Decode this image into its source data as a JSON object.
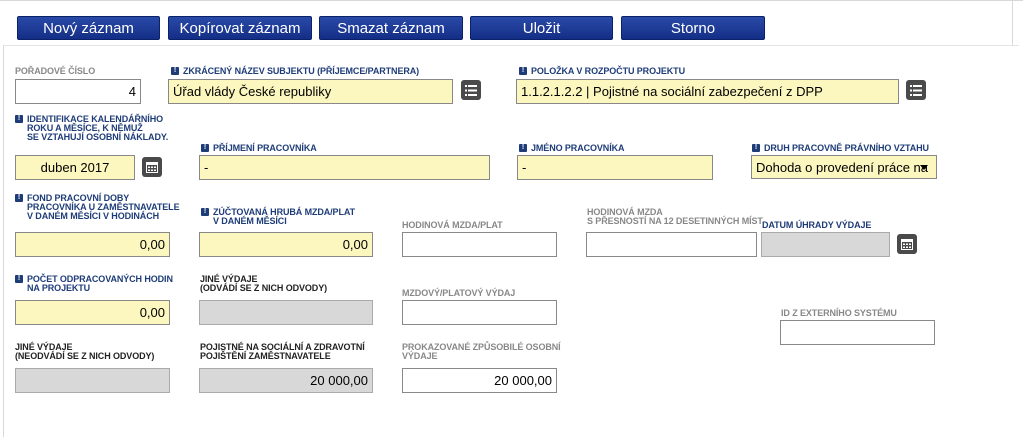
{
  "toolbar": {
    "new_label": "Nový záznam",
    "copy_label": "Kopírovat záznam",
    "delete_label": "Smazat záznam",
    "save_label": "Uložit",
    "cancel_label": "Storno"
  },
  "form": {
    "poradove_cislo": {
      "label": "POŘADOVÉ ČÍSLO",
      "value": "4"
    },
    "nazev_subjektu": {
      "label": "ZKRÁCENÝ NÁZEV SUBJEKTU (PŘÍJEMCE/PARTNERA)",
      "value": "Úřad vlády České republiky"
    },
    "polozka_rozpoctu": {
      "label": "POLOŽKA V ROZPOČTU PROJEKTU",
      "value": "1.1.2.1.2.2 | Pojistné na sociální zabezpečení z DPP"
    },
    "identifikace_roku": {
      "label_line1": "IDENTIFIKACE KALENDÁŘNÍHO",
      "label_line2": "ROKU A MĚSÍCE, K NĚMUŽ",
      "label_line3": "SE VZTAHUJÍ OSOBNÍ NÁKLADY.",
      "value": "duben 2017"
    },
    "prijmeni": {
      "label": "PŘÍJMENÍ PRACOVNÍKA",
      "value": "-"
    },
    "jmeno": {
      "label": "JMÉNO PRACOVNÍKA",
      "value": "-"
    },
    "druh_vztahu": {
      "label": "DRUH PRACOVNĚ PRÁVNÍHO VZTAHU",
      "value": "Dohoda o provedení práce na"
    },
    "fond_doby": {
      "label_line1": "FOND PRACOVNÍ DOBY",
      "label_line2": "PRACOVNÍKA U ZAMĚSTNAVATELE",
      "label_line3": "V DANÉM MĚSÍCI V HODINÁCH",
      "value": "0,00"
    },
    "hruba_mzda": {
      "label_line1": "ZÚČTOVANÁ HRUBÁ MZDA/PLAT",
      "label_line2": "V DANÉM MĚSÍCI",
      "value": "0,00"
    },
    "hodinova_mzda": {
      "label": "HODINOVÁ MZDA/PLAT",
      "value": ""
    },
    "hodinova_mzda_12": {
      "label_line1": "HODINOVÁ MZDA",
      "label_line2": "S PŘESNOSTÍ NA 12 DESETINNÝCH MÍST",
      "value": ""
    },
    "datum_uhrady": {
      "label": "DATUM ÚHRADY VÝDAJE",
      "value": ""
    },
    "pocet_hodin": {
      "label_line1": "POČET ODPRACOVANÝCH HODIN",
      "label_line2": "NA PROJEKTU",
      "value": "0,00"
    },
    "jine_vydaje_odvadi": {
      "label_line1": "JINÉ VÝDAJE",
      "label_line2": "(ODVÁDÍ SE Z NICH ODVODY)",
      "value": ""
    },
    "mzdovy_vydaj": {
      "label": "MZDOVÝ/PLATOVÝ VÝDAJ",
      "value": ""
    },
    "id_externiho": {
      "label": "ID Z EXTERNÍHO SYSTÉMU",
      "value": ""
    },
    "jine_vydaje_neodvadi": {
      "label_line1": "JINÉ VÝDAJE",
      "label_line2": "(NEODVÁDÍ SE Z NICH ODVODY)",
      "value": ""
    },
    "pojistne": {
      "label_line1": "POJISTNÉ NA SOCIÁLNÍ A ZDRAVOTNÍ",
      "label_line2": "POJIŠTĚNÍ ZAMĚSTNAVATELE",
      "value": "20 000,00"
    },
    "prokazovane": {
      "label_line1": "PROKAZOVANÉ ZPŮSOBILÉ OSOBNÍ",
      "label_line2": "VÝDAJE",
      "value": "20 000,00"
    }
  },
  "icons": {
    "list": "list-icon",
    "calendar": "calendar-icon",
    "required": "required-icon"
  }
}
